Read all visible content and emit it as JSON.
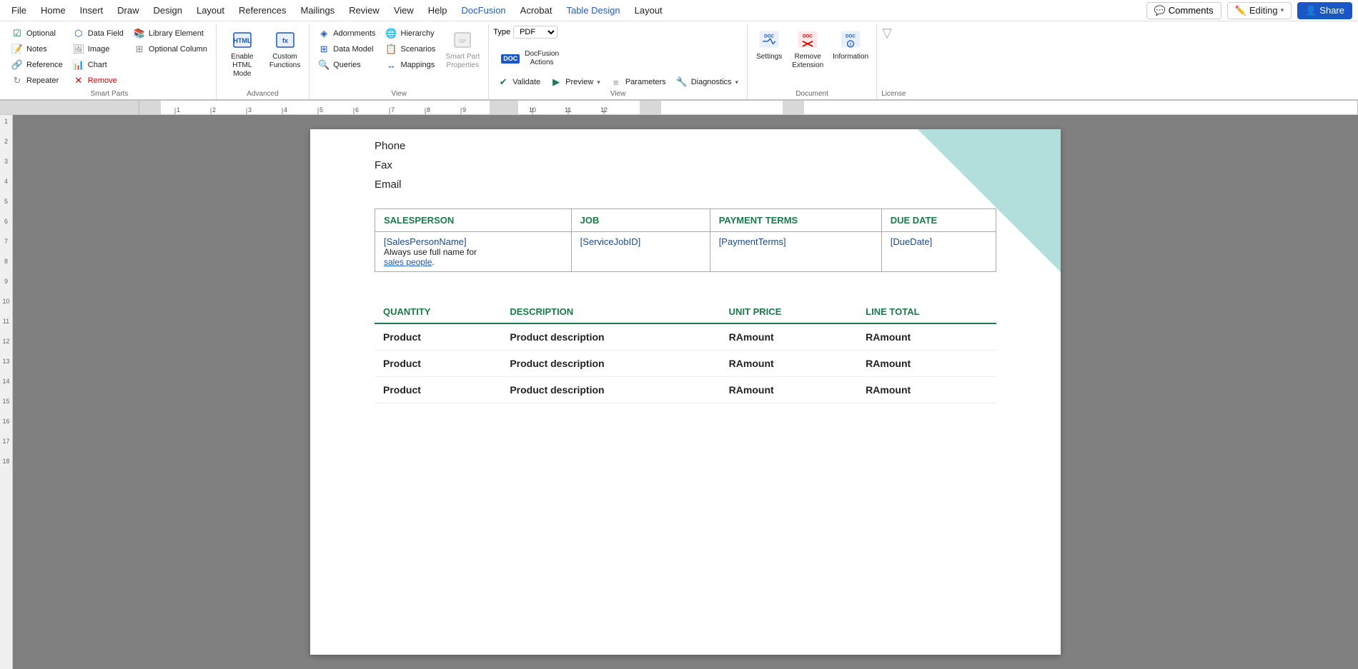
{
  "menubar": {
    "items": [
      "File",
      "Home",
      "Insert",
      "Draw",
      "Design",
      "Layout",
      "References",
      "Mailings",
      "Review",
      "View",
      "Help",
      "DocFusion",
      "Acrobat",
      "Table Design",
      "Layout"
    ]
  },
  "topright": {
    "comments_label": "Comments",
    "editing_label": "Editing",
    "share_label": "Share"
  },
  "ribbon": {
    "smart_parts_group": "Smart Parts",
    "advanced_group": "Advanced",
    "view_group": "View",
    "document_group": "Document",
    "license_group": "License",
    "buttons": {
      "optional": "Optional",
      "notes": "Notes",
      "reference": "Reference",
      "repeater": "Repeater",
      "data_field": "Data Field",
      "image": "Image",
      "chart": "Chart",
      "remove": "Remove",
      "library_element": "Library Element",
      "optional_column": "Optional Column",
      "enable_html_mode": "Enable\nHTML Mode",
      "custom_functions": "Custom\nFunctions",
      "adornments": "Adornments",
      "data_model": "Data Model",
      "queries": "Queries",
      "smart_part_properties": "Smart Part\nProperties",
      "hierarchy": "Hierarchy",
      "scenarios": "Scenarios",
      "mappings": "Mappings",
      "type_label": "Type",
      "type_value": "PDF",
      "docfusion_actions": "DocFusion\nActions",
      "validate": "Validate",
      "preview": "Preview",
      "parameters": "Parameters",
      "diagnostics": "Diagnostics",
      "settings": "Settings",
      "remove_extension": "Remove\nExtension",
      "information": "Information"
    }
  },
  "document": {
    "contact_lines": [
      "Phone",
      "Fax",
      "Email"
    ],
    "upper_table": {
      "headers": [
        "SALESPERSON",
        "JOB",
        "PAYMENT TERMS",
        "DUE DATE"
      ],
      "row1": [
        "[SalesPersonName]",
        "[ServiceJobID]",
        "[PaymentTerms]",
        "[DueDate]"
      ],
      "note": "Always use full name for",
      "note_link": "sales people"
    },
    "lower_table": {
      "headers": [
        "QUANTITY",
        "DESCRIPTION",
        "UNIT PRICE",
        "LINE TOTAL"
      ],
      "rows": [
        [
          "Product",
          "Product description",
          "RAmount",
          "RAmount"
        ],
        [
          "Product",
          "Product description",
          "RAmount",
          "RAmount"
        ],
        [
          "Product",
          "Product description",
          "RAmount",
          "RAmount"
        ]
      ]
    }
  },
  "ruler": {
    "numbers": [
      "1",
      "2",
      "3",
      "4",
      "5",
      "6",
      "7",
      "8",
      "9",
      "10",
      "11",
      "12",
      "13",
      "14",
      "15",
      "16",
      "17",
      "18"
    ]
  }
}
